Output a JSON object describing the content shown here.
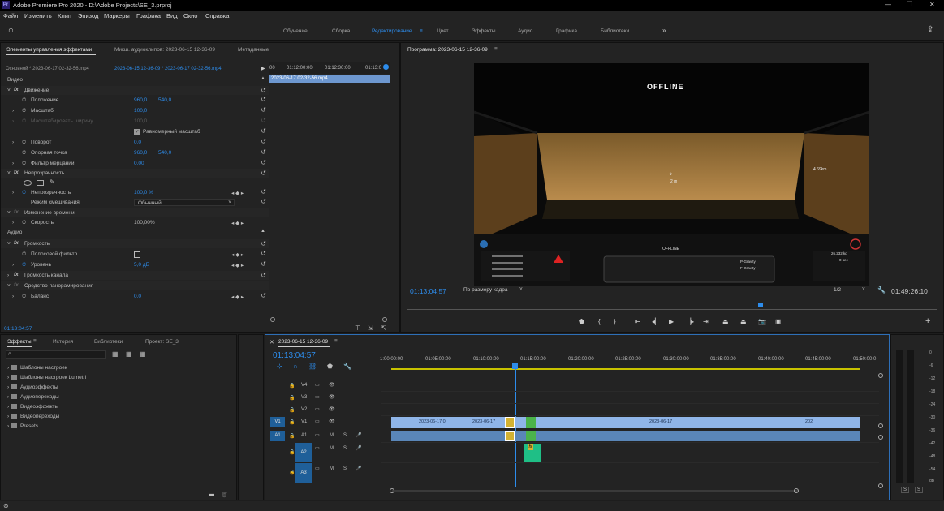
{
  "window": {
    "title": "Adobe Premiere Pro 2020 - D:\\Adobe Projects\\SE_3.prproj",
    "app_icon": "Pr"
  },
  "menu": [
    "Файл",
    "Изменить",
    "Клип",
    "Эпизод",
    "Маркеры",
    "Графика",
    "Вид",
    "Окно",
    "Справка"
  ],
  "workspaces": [
    "Обучение",
    "Сборка",
    "Редактирование",
    "Цвет",
    "Эффекты",
    "Аудио",
    "Графика",
    "Библиотеки"
  ],
  "effect_controls": {
    "tabs": [
      "Элементы управления эффектами",
      "Микш. аудиоклипов: 2023-06-15 12-36-09",
      "Метаданные"
    ],
    "source_master": "Основной * 2023-06-17 02-32-56.mp4",
    "source_seq": "2023-06-15 12-36-09 * 2023-06-17 02-32-56.mp4",
    "ruler": [
      "00",
      "01:12:00:00",
      "01:12:30:00",
      "01:13:0"
    ],
    "clip_name": "2023-06-17 02-32-56.mp4",
    "video": "Видео",
    "motion": "Движение",
    "position": {
      "label": "Положение",
      "x": "960,0",
      "y": "540,0"
    },
    "scale": {
      "label": "Масштаб",
      "v": "100,0"
    },
    "scale_width": {
      "label": "Масштабировать ширину",
      "v": "100,0"
    },
    "uniform": "Равномерный масштаб",
    "rotation": {
      "label": "Поворот",
      "v": "0,0"
    },
    "anchor": {
      "label": "Опорная точка",
      "x": "960,0",
      "y": "540,0"
    },
    "flicker": {
      "label": "Фильтр мерцаний",
      "v": "0,00"
    },
    "opacity_sect": "Непрозрачность",
    "opacity": {
      "label": "Непрозрачность",
      "v": "100,0 %"
    },
    "blend": {
      "label": "Режим смешивания",
      "v": "Обычный"
    },
    "time_remap": "Изменение времени",
    "speed": {
      "label": "Скорость",
      "v": "100,00%"
    },
    "audio": "Аудио",
    "volume": "Громкость",
    "bypass": "Полосовой фильтр",
    "level": {
      "label": "Уровень",
      "v": "5,0 дБ"
    },
    "channel_vol": "Громкость канала",
    "panner": "Средство панорамирования",
    "balance": {
      "label": "Баланс",
      "v": "0,0"
    },
    "timecode": "01:13:04:57"
  },
  "program": {
    "title": "Программа: 2023-06-15 12-36-09",
    "offline": "OFFLINE",
    "offline2": "OFFLINE",
    "timecode": "01:13:04:57",
    "fit": "По размеру кадра",
    "quality": "1/2",
    "duration": "01:49:26:10"
  },
  "project": {
    "tabs": [
      "Эффекты",
      "История",
      "Библиотеки",
      "Проект: SE_3"
    ],
    "folders": [
      "Шаблоны настроек",
      "Шаблоны настроек Lumetri",
      "Аудиоэффекты",
      "Аудиопереходы",
      "Видеоэффекты",
      "Видеопереходы",
      "Presets"
    ]
  },
  "timeline": {
    "seq": "2023-06-15 12-36-09",
    "timecode": "01:13:04:57",
    "ruler": [
      "1:00:00:00",
      "01:05:00:00",
      "01:10:00:00",
      "01:15:00:00",
      "01:20:00:00",
      "01:25:00:00",
      "01:30:00:00",
      "01:35:00:00",
      "01:40:00:00",
      "01:45:00:00",
      "01:50:00:0"
    ],
    "tracks": {
      "v4": "V4",
      "v3": "V3",
      "v2": "V2",
      "v1": "V1",
      "a1": "A1",
      "a2": "A2",
      "a3": "A3",
      "src_v1": "V1",
      "src_a1": "A1"
    },
    "m": "M",
    "s": "S",
    "clip_labels": [
      "2023-06-17 0",
      "2023-06-17",
      "2023-06-17",
      "202"
    ],
    "fx": "fx"
  },
  "meter": {
    "labels": [
      "0",
      "-6",
      "-12",
      "-18",
      "-24",
      "-30",
      "-36",
      "-42",
      "-48",
      "-54",
      "dB"
    ],
    "s": "S"
  },
  "hud": {
    "dist": "2 m",
    "dist2": "4.69km",
    "coords": "26,232 kg",
    "secs": "0 sec",
    "grav": "P-Gravity",
    "grav2": "F-Gravity"
  }
}
